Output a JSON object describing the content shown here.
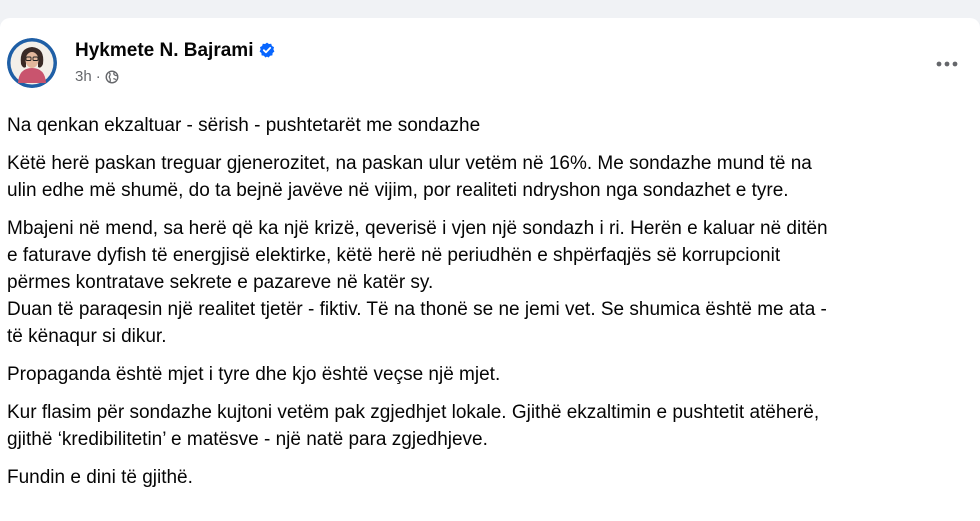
{
  "post": {
    "author": "Hykmete N. Bajrami",
    "time": "3h",
    "separator": "·",
    "paragraphs": [
      "Na qenkan ekzaltuar - sërish - pushtetarët me sondazhe",
      "Këtë herë paskan treguar gjenerozitet, na paskan ulur vetëm në 16%. Me sondazhe mund të na\nulin edhe më shumë, do ta bejnë javëve në vijim, por realiteti ndryshon nga sondazhet e tyre.",
      "Mbajeni në mend, sa herë që ka një krizë, qeverisë i vjen një sondazh i ri. Herën e kaluar në ditën\ne faturave dyfish të energjisë elektirke, këtë herë në periudhën e shpërfaqjës së korrupcionit\npërmes kontratave sekrete e pazareve në katër sy.\nDuan të paraqesin një realitet tjetër - fiktiv. Të na thonë se ne jemi vet. Se shumica është me ata -\ntë kënaqur si dikur.",
      "Propaganda është mjet i tyre dhe kjo është veçse një mjet.",
      "Kur flasim për sondazhe kujtoni vetëm pak zgjedhjet lokale. Gjithë ekzaltimin e pushtetit atëherë,\ngjithë ‘kredibilitetin’ e matësve - një natë para zgjedhjeve.",
      "Fundin e dini të gjithë."
    ]
  },
  "icons": {
    "avatar": "avatar-photo",
    "verified": "verified-badge-icon",
    "audience": "globe-icon",
    "more": "more-options-icon"
  },
  "colors": {
    "verified": "#0866ff",
    "secondary_text": "#65676b",
    "primary_text": "#050505"
  }
}
